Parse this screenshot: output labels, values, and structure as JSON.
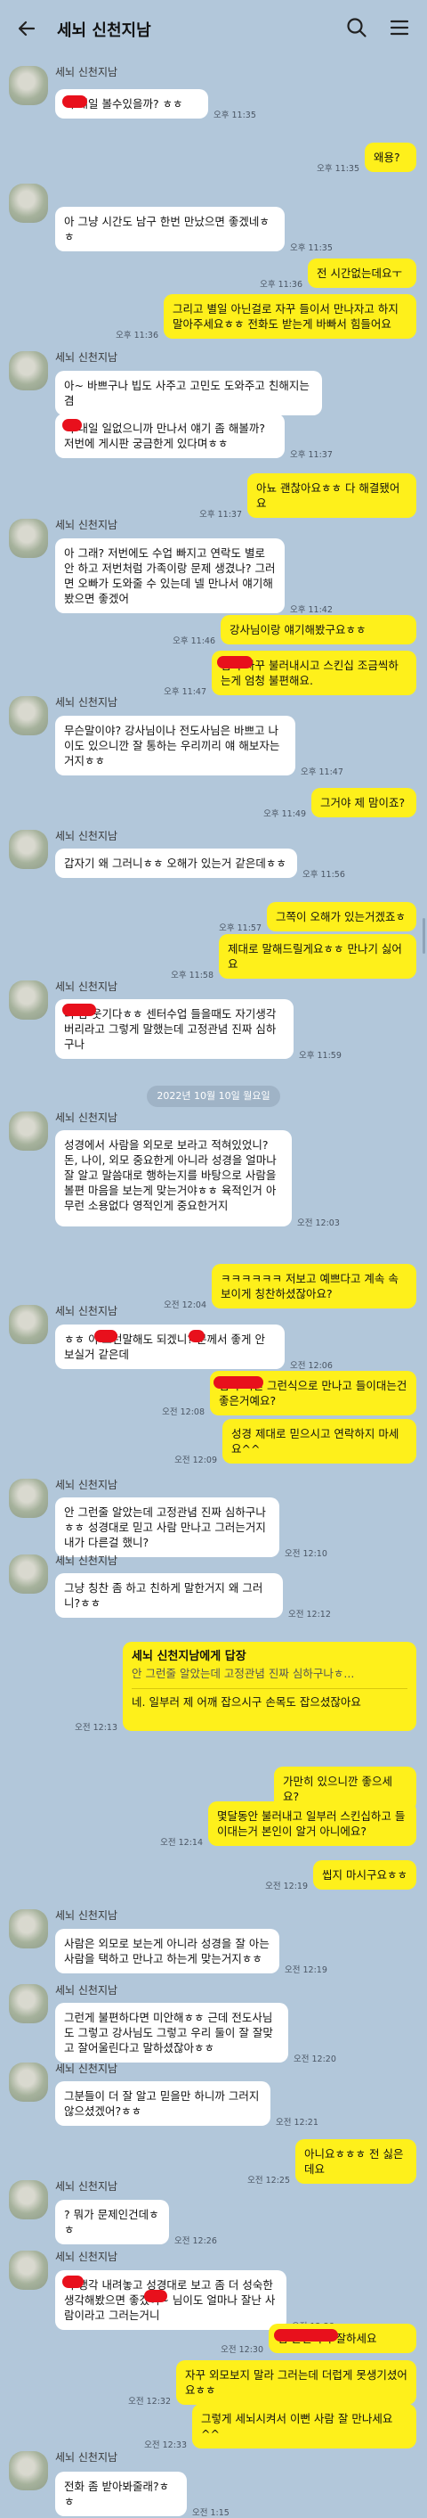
{
  "header": {
    "title": "세뇌 신천지남"
  },
  "date_divider": "2022년 10월 10일 월요일",
  "messages": [
    {
      "dir": "in",
      "sender": "세뇌 신천지남",
      "text": "이 내일 볼수있을까? ㅎㅎ",
      "time": "오후 11:35"
    },
    {
      "dir": "out",
      "text": "왜용?",
      "time": "오후 11:35"
    },
    {
      "dir": "in",
      "text": "아 그냥 시간도 남구 한번 만났으면 좋겠네ㅎㅎ",
      "time": "오후 11:35"
    },
    {
      "dir": "out",
      "text": "전 시간없는데요ㅜ",
      "time": "오후 11:36"
    },
    {
      "dir": "out",
      "text": "그리고 별일 아닌걸로 자꾸 들이서 만나자고 하지 말아주세요ㅎㅎ 전화도 받는게 바빠서 힘들어요",
      "time": "오후 11:36"
    },
    {
      "dir": "in",
      "sender": "세뇌 신천지남",
      "text": "아~ 바쁘구나 빕도 사주고 고민도 도와주고 친해지는겸",
      "time": ""
    },
    {
      "dir": "in",
      "text": "이 내일 일없으니까 만나서 얘기 좀 해볼까? 저번에 게시판 궁금한게 있다며ㅎㅎ",
      "time": "오후 11:37"
    },
    {
      "dir": "out",
      "text": "아뇨 괜찮아요ㅎㅎ 다 해결됐어요",
      "time": "오후 11:37"
    },
    {
      "dir": "in",
      "sender": "세뇌 신천지남",
      "text": "아 그래? 저번에도 수업 빠지고 연락도 별로 안 하고 저번처럼 가족이랑 문제 생겼나? 그러면 오빠가 도와줄 수 있는데 넬 만나서 얘기해봤으면 좋겠어",
      "time": "오후 11:42"
    },
    {
      "dir": "out",
      "text": "강사님이랑 얘기해봤구요ㅎㅎ",
      "time": "오후 11:46"
    },
    {
      "dir": "out",
      "text": "님이 자꾸 불러내시고 스킨십 조금씩하는게 엄청 불편해요.",
      "time": "오후 11:47"
    },
    {
      "dir": "in",
      "sender": "세뇌 신천지남",
      "text": "무슨말이야? 강사님이나 전도사님은 바쁘고 나이도 있으니깐 잘 통하는 우리끼리 얘 해보자는거지ㅎㅎ",
      "time": "오후 11:47"
    },
    {
      "dir": "out",
      "text": "그거야 제 맘이죠?",
      "time": "오후 11:49"
    },
    {
      "dir": "in",
      "sender": "세뇌 신천지남",
      "text": "갑자기 왜 그러니ㅎㅎ 오해가 있는거 같은데ㅎㅎ",
      "time": "오후 11:56"
    },
    {
      "dir": "out",
      "text": "그쪽이 오해가 있는거겠죠ㅎ",
      "time": "오후 11:57"
    },
    {
      "dir": "out",
      "text": "제대로 말해드릴게요ㅎㅎ 만나기 싫어요",
      "time": "오후 11:58"
    },
    {
      "dir": "in",
      "sender": "세뇌 신천지남",
      "text": "너 참 웃기다ㅎㅎ 센터수업 들을때도 자기생각 버리라고 그렇게 말했는데 고정관념 진짜 심하구나",
      "time": "오후 11:59"
    },
    {
      "dir": "in",
      "sender": "세뇌 신천지남",
      "text": "성경에서 사람을 외모로 보라고 적혀있었니? 돈, 나이, 외모 중요한게 아니라 성경을 얼마나 잘 알고 말씀대로 행하는지를 바탕으로 사람을 볼편 마음을 보는게 맞는거야ㅎㅎ 육적인거 아무런 소용없다 영적인게 중요한거지",
      "time": "오전 12:03"
    },
    {
      "dir": "out",
      "text": "ㅋㅋㅋㅋㅋㅋ 저보고 예쁘다고 계속 속보이게 칭찬하셨잖아요?",
      "time": "오전 12:04"
    },
    {
      "dir": "in",
      "sender": "세뇌 신천지남",
      "text": "ㅎㅎ 이 그런말해도 되겠니? 분께서 좋게 안 보실거 같은데",
      "time": "오전 12:06"
    },
    {
      "dir": "out",
      "text": "님의 저런 그런식으로 만나고 들이대는건 좋은거예요?",
      "time": "오전 12:08"
    },
    {
      "dir": "out",
      "text": "성경 제대로 믿으시고 연락하지 마세요^^",
      "time": "오전 12:09"
    },
    {
      "dir": "in",
      "sender": "세뇌 신천지남",
      "text": "안 그런줄 알았는데 고정관념 진짜 심하구나ㅎㅎ 성경대로 믿고 사람 만나고 그러는거지 내가 다른걸 했니?",
      "time": "오전 12:10"
    },
    {
      "dir": "in",
      "sender": "세뇌 신천지남",
      "text": "그냥 칭찬 좀 하고 친하게 말한거지 왜 그러니?ㅎㅎ",
      "time": "오전 12:12"
    },
    {
      "dir": "out",
      "reply": {
        "title": "세뇌 신천지남에게 답장",
        "quote": "안 그런줄 알았는데 고정관념 진짜 심하구나ㅎ..."
      },
      "text": "네. 일부러 제 어깨 잡으시구 손목도 잡으셨잖아요",
      "time": "오전 12:13"
    },
    {
      "dir": "out",
      "text": "가만히 있으니깐 좋으세요?",
      "time": "오전 12:14"
    },
    {
      "dir": "out",
      "text": "몇달동안 불러내고 일부러 스킨십하고 들이대는거 본인이 알거 아니에요?",
      "time": "오전 12:14"
    },
    {
      "dir": "out",
      "text": "씹지 마시구요ㅎㅎ",
      "time": "오전 12:19"
    },
    {
      "dir": "in",
      "sender": "세뇌 신천지남",
      "text": "사람은 외모로 보는게 아니라 성경을 잘 아는 사람을 택하고 만나고 하는게 맞는거지ㅎㅎ",
      "time": "오전 12:19"
    },
    {
      "dir": "in",
      "sender": "세뇌 신천지남",
      "text": "그런게 불편하다면 미안해ㅎㅎ 근데 전도사님도 그렇고 강사님도 그렇고 우리 둘이 잘 잘맞고 잘어울린다고 말하셨잖아ㅎㅎ",
      "time": "오전 12:20"
    },
    {
      "dir": "in",
      "sender": "세뇌 신천지남",
      "text": "그분들이 더 잘 알고 믿을만 하니까 그러지 않으셨겠어?ㅎㅎ",
      "time": "오전 12:21"
    },
    {
      "dir": "out",
      "text": "아니요ㅎㅎㅎ 전 싫은데요",
      "time": "오전 12:25"
    },
    {
      "dir": "in",
      "sender": "세뇌 신천지남",
      "text": "? 뭐가 문제인건데ㅎㅎ",
      "time": "오전 12:26"
    },
    {
      "dir": "in",
      "sender": "세뇌 신천지남",
      "text": "이 생각 내려놓고 성경대로 보고 좀 더 성숙한 생각해봤으면 좋겠어~ 님이도 얼마나 잘난 사람이라고 그러는거니",
      "time": "오전 12:28"
    },
    {
      "dir": "out",
      "text": "님 본인이나 잘하세요",
      "time": "오전 12:30"
    },
    {
      "dir": "out",
      "text": "자꾸 외모보지 말라 그러는데 더럽게 못생기셨어요ㅎㅎ",
      "time": "오전 12:32"
    },
    {
      "dir": "out",
      "text": "그렇게 세뇌시켜서 이뻔 사람 잘 만나세요^^",
      "time": "오전 12:33"
    },
    {
      "dir": "in",
      "sender": "세뇌 신천지남",
      "text": "전화 좀 받아봐줄래?ㅎㅎ",
      "time": "오전 1:15"
    }
  ]
}
